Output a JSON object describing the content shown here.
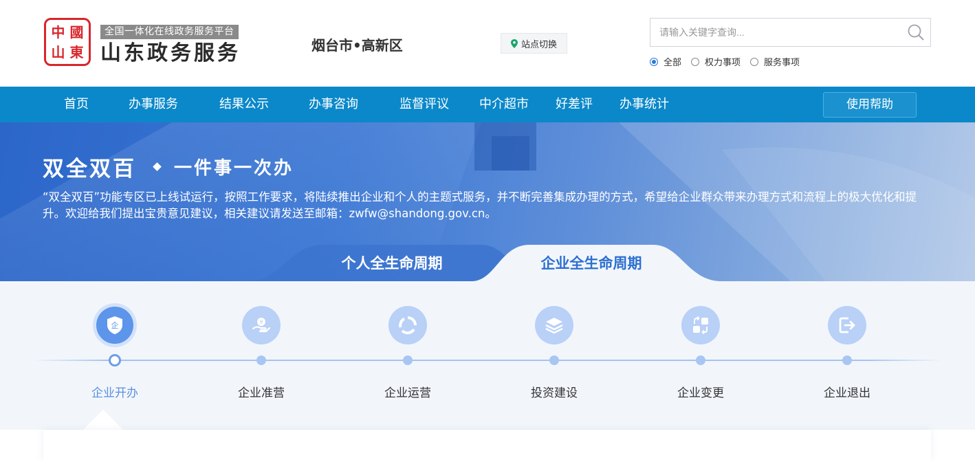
{
  "header": {
    "seal_chars": [
      "中",
      "國",
      "山",
      "東"
    ],
    "platform_tag": "全国一体化在线政务服务平台",
    "site_title": "山东政务服务",
    "city": "烟台市•高新区",
    "station_switch": "站点切换",
    "search": {
      "placeholder": "请输入关键字查询..."
    },
    "radio_options": [
      {
        "label": "全部",
        "selected": true
      },
      {
        "label": "权力事项",
        "selected": false
      },
      {
        "label": "服务事项",
        "selected": false
      }
    ]
  },
  "nav": {
    "items": [
      "首页",
      "办事服务",
      "结果公示",
      "办事咨询",
      "监督评议",
      "中介超市",
      "好差评",
      "办事统计"
    ],
    "help": "使用帮助"
  },
  "banner": {
    "title": "双全双百",
    "subtitle": "一件事一次办",
    "description": "“双全双百”功能专区已上线试运行，按照工作要求，将陆续推出企业和个人的主题式服务，并不断完善集成办理的方式，希望给企业群众带来办理方式和流程上的极大优化和提升。欢迎给我们提出宝贵意见建议，相关建议请发送至邮箱：zwfw@shandong.gov.cn。",
    "tabs": [
      {
        "label": "个人全生命周期",
        "active": false
      },
      {
        "label": "企业全生命周期",
        "active": true
      }
    ]
  },
  "lifecycle": {
    "stages": [
      {
        "label": "企业开办",
        "icon": "shield-icon",
        "active": true,
        "icon_char": "企"
      },
      {
        "label": "企业准营",
        "icon": "hand-coin-icon",
        "active": false
      },
      {
        "label": "企业运营",
        "icon": "cycle-icon",
        "active": false
      },
      {
        "label": "投资建设",
        "icon": "layers-icon",
        "active": false
      },
      {
        "label": "企业变更",
        "icon": "swap-blocks-icon",
        "active": false
      },
      {
        "label": "企业退出",
        "icon": "exit-icon",
        "active": false
      }
    ]
  },
  "colors": {
    "nav_bg": "#0b88c9",
    "accent_blue": "#2c6fd0",
    "seal_red": "#d8262c",
    "active_stage": "#5c95ea"
  }
}
